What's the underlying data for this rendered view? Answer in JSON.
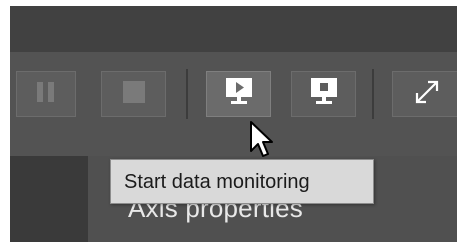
{
  "toolbar": {
    "buttons": [
      {
        "name": "pause-button",
        "icon": "pause-icon"
      },
      {
        "name": "stop-button",
        "icon": "stop-icon"
      },
      {
        "name": "start-data-monitoring-button",
        "icon": "monitor-play-icon",
        "hovered": true
      },
      {
        "name": "stop-data-monitoring-button",
        "icon": "monitor-stop-icon"
      },
      {
        "name": "fullscreen-button",
        "icon": "expand-icon"
      }
    ]
  },
  "tooltip": {
    "text": "Start data monitoring"
  },
  "panel": {
    "title": "Axis properties"
  },
  "colors": {
    "toolbar_bg": "#535353",
    "button_bg": "#5d5d5d",
    "tooltip_bg": "#d9d9d9",
    "text_light": "#e8e8e8"
  }
}
